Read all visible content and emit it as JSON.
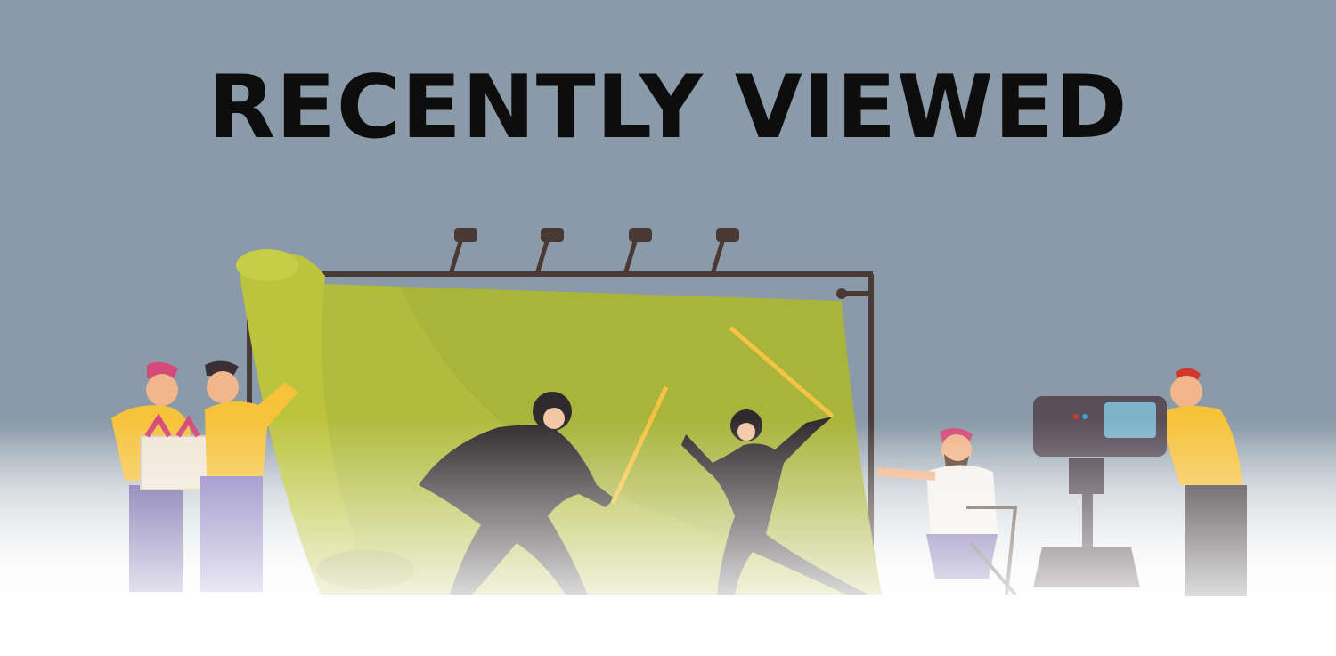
{
  "banner": {
    "title": "RECENTLY VIEWED"
  }
}
